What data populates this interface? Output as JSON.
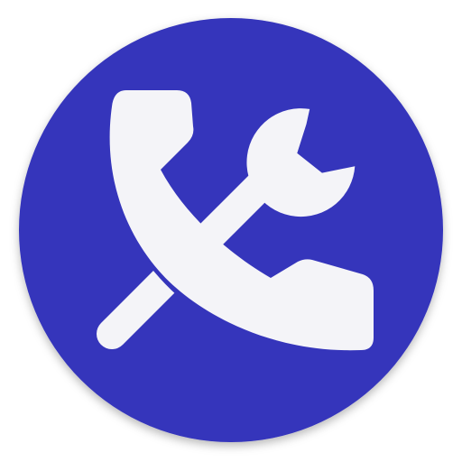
{
  "icon": {
    "badge_icon": "phone-wrench-icon",
    "colors": {
      "background": "#ffffff",
      "circle": "#3434bb",
      "glyph": "#f4f4f8"
    }
  }
}
